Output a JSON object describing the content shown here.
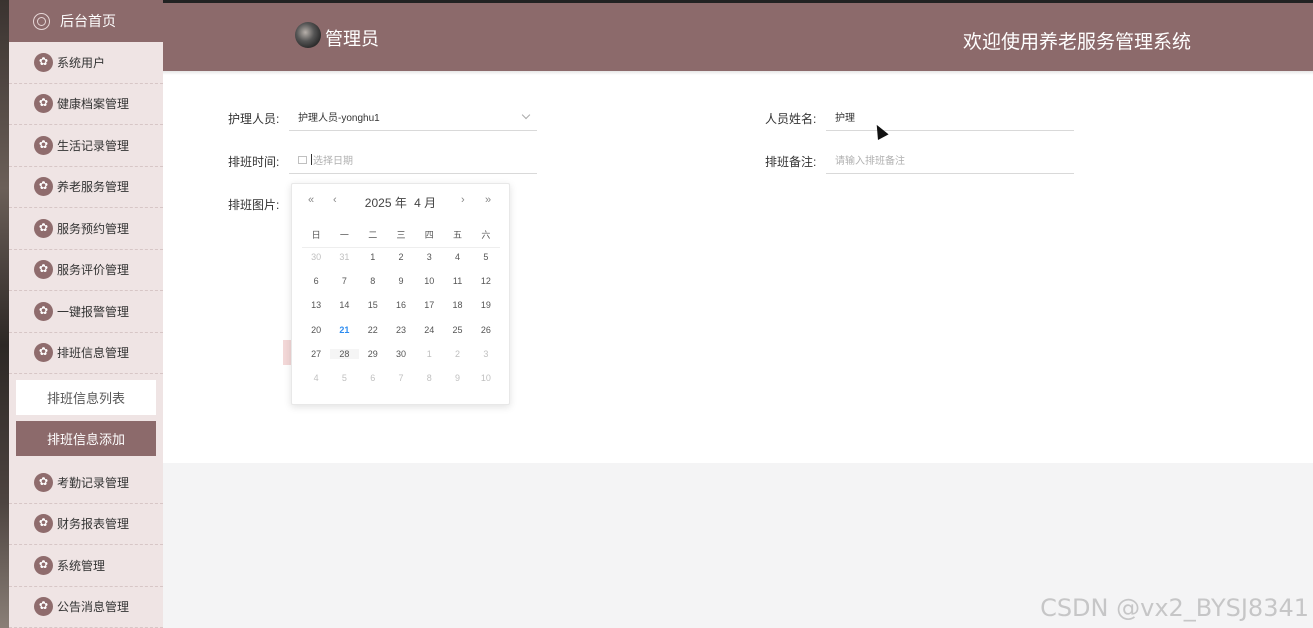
{
  "sidebar": {
    "home": "后台首页",
    "items_top": [
      "系统用户",
      "健康档案管理",
      "生活记录管理",
      "养老服务管理",
      "服务预约管理",
      "服务评价管理",
      "一键报警管理",
      "排班信息管理"
    ],
    "sub_items": [
      "排班信息列表",
      "排班信息添加"
    ],
    "items_bottom": [
      "考勤记录管理",
      "财务报表管理",
      "系统管理",
      "公告消息管理"
    ]
  },
  "header": {
    "admin": "管理员",
    "welcome": "欢迎使用养老服务管理系统"
  },
  "form": {
    "nurse_label": "护理人员:",
    "nurse_value": "护理人员-yonghu1",
    "name_label": "人员姓名:",
    "name_value": "护理",
    "time_label": "排班时间:",
    "time_placeholder": "选择日期",
    "note_label": "排班备注:",
    "note_placeholder": "请输入排班备注",
    "image_label": "排班图片:"
  },
  "calendar": {
    "year": "2025 年",
    "month": "4 月",
    "prev_year": "«",
    "prev_month": "‹",
    "next_month": "›",
    "next_year": "»",
    "weekdays": [
      "日",
      "一",
      "二",
      "三",
      "四",
      "五",
      "六"
    ],
    "rows": [
      [
        "30",
        "31",
        "1",
        "2",
        "3",
        "4",
        "5"
      ],
      [
        "6",
        "7",
        "8",
        "9",
        "10",
        "11",
        "12"
      ],
      [
        "13",
        "14",
        "15",
        "16",
        "17",
        "18",
        "19"
      ],
      [
        "20",
        "21",
        "22",
        "23",
        "24",
        "25",
        "26"
      ],
      [
        "27",
        "28",
        "29",
        "30",
        "1",
        "2",
        "3"
      ],
      [
        "4",
        "5",
        "6",
        "7",
        "8",
        "9",
        "10"
      ]
    ],
    "today": "21"
  },
  "watermark": "CSDN @vx2_BYSJ8341"
}
